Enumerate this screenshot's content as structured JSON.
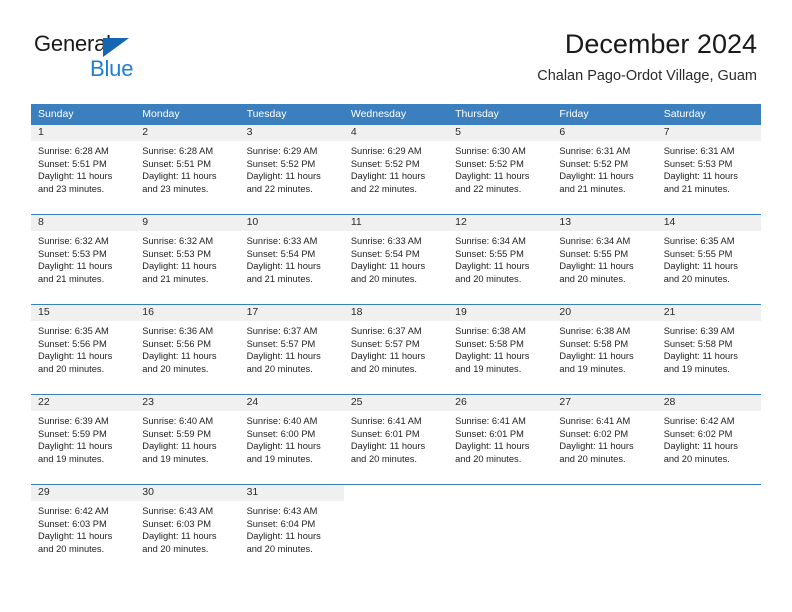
{
  "logo": {
    "word_one": "General",
    "word_two": "Blue",
    "triangle_color": "#1565b0",
    "blue_color": "#1d7fd4"
  },
  "header": {
    "title": "December 2024",
    "subtitle": "Chalan Pago-Ordot Village, Guam"
  },
  "theme": {
    "header_blue": "#3c7fbf",
    "daynum_band": "#f0f0f0",
    "text": "#1f1f1f"
  },
  "weekdays": [
    "Sunday",
    "Monday",
    "Tuesday",
    "Wednesday",
    "Thursday",
    "Friday",
    "Saturday"
  ],
  "weeks": [
    {
      "days": [
        {
          "day": "1",
          "sunrise": "Sunrise: 6:28 AM",
          "sunset": "Sunset: 5:51 PM",
          "daylight_1": "Daylight: 11 hours",
          "daylight_2": "and 23 minutes."
        },
        {
          "day": "2",
          "sunrise": "Sunrise: 6:28 AM",
          "sunset": "Sunset: 5:51 PM",
          "daylight_1": "Daylight: 11 hours",
          "daylight_2": "and 23 minutes."
        },
        {
          "day": "3",
          "sunrise": "Sunrise: 6:29 AM",
          "sunset": "Sunset: 5:52 PM",
          "daylight_1": "Daylight: 11 hours",
          "daylight_2": "and 22 minutes."
        },
        {
          "day": "4",
          "sunrise": "Sunrise: 6:29 AM",
          "sunset": "Sunset: 5:52 PM",
          "daylight_1": "Daylight: 11 hours",
          "daylight_2": "and 22 minutes."
        },
        {
          "day": "5",
          "sunrise": "Sunrise: 6:30 AM",
          "sunset": "Sunset: 5:52 PM",
          "daylight_1": "Daylight: 11 hours",
          "daylight_2": "and 22 minutes."
        },
        {
          "day": "6",
          "sunrise": "Sunrise: 6:31 AM",
          "sunset": "Sunset: 5:52 PM",
          "daylight_1": "Daylight: 11 hours",
          "daylight_2": "and 21 minutes."
        },
        {
          "day": "7",
          "sunrise": "Sunrise: 6:31 AM",
          "sunset": "Sunset: 5:53 PM",
          "daylight_1": "Daylight: 11 hours",
          "daylight_2": "and 21 minutes."
        }
      ]
    },
    {
      "days": [
        {
          "day": "8",
          "sunrise": "Sunrise: 6:32 AM",
          "sunset": "Sunset: 5:53 PM",
          "daylight_1": "Daylight: 11 hours",
          "daylight_2": "and 21 minutes."
        },
        {
          "day": "9",
          "sunrise": "Sunrise: 6:32 AM",
          "sunset": "Sunset: 5:53 PM",
          "daylight_1": "Daylight: 11 hours",
          "daylight_2": "and 21 minutes."
        },
        {
          "day": "10",
          "sunrise": "Sunrise: 6:33 AM",
          "sunset": "Sunset: 5:54 PM",
          "daylight_1": "Daylight: 11 hours",
          "daylight_2": "and 21 minutes."
        },
        {
          "day": "11",
          "sunrise": "Sunrise: 6:33 AM",
          "sunset": "Sunset: 5:54 PM",
          "daylight_1": "Daylight: 11 hours",
          "daylight_2": "and 20 minutes."
        },
        {
          "day": "12",
          "sunrise": "Sunrise: 6:34 AM",
          "sunset": "Sunset: 5:55 PM",
          "daylight_1": "Daylight: 11 hours",
          "daylight_2": "and 20 minutes."
        },
        {
          "day": "13",
          "sunrise": "Sunrise: 6:34 AM",
          "sunset": "Sunset: 5:55 PM",
          "daylight_1": "Daylight: 11 hours",
          "daylight_2": "and 20 minutes."
        },
        {
          "day": "14",
          "sunrise": "Sunrise: 6:35 AM",
          "sunset": "Sunset: 5:55 PM",
          "daylight_1": "Daylight: 11 hours",
          "daylight_2": "and 20 minutes."
        }
      ]
    },
    {
      "days": [
        {
          "day": "15",
          "sunrise": "Sunrise: 6:35 AM",
          "sunset": "Sunset: 5:56 PM",
          "daylight_1": "Daylight: 11 hours",
          "daylight_2": "and 20 minutes."
        },
        {
          "day": "16",
          "sunrise": "Sunrise: 6:36 AM",
          "sunset": "Sunset: 5:56 PM",
          "daylight_1": "Daylight: 11 hours",
          "daylight_2": "and 20 minutes."
        },
        {
          "day": "17",
          "sunrise": "Sunrise: 6:37 AM",
          "sunset": "Sunset: 5:57 PM",
          "daylight_1": "Daylight: 11 hours",
          "daylight_2": "and 20 minutes."
        },
        {
          "day": "18",
          "sunrise": "Sunrise: 6:37 AM",
          "sunset": "Sunset: 5:57 PM",
          "daylight_1": "Daylight: 11 hours",
          "daylight_2": "and 20 minutes."
        },
        {
          "day": "19",
          "sunrise": "Sunrise: 6:38 AM",
          "sunset": "Sunset: 5:58 PM",
          "daylight_1": "Daylight: 11 hours",
          "daylight_2": "and 19 minutes."
        },
        {
          "day": "20",
          "sunrise": "Sunrise: 6:38 AM",
          "sunset": "Sunset: 5:58 PM",
          "daylight_1": "Daylight: 11 hours",
          "daylight_2": "and 19 minutes."
        },
        {
          "day": "21",
          "sunrise": "Sunrise: 6:39 AM",
          "sunset": "Sunset: 5:58 PM",
          "daylight_1": "Daylight: 11 hours",
          "daylight_2": "and 19 minutes."
        }
      ]
    },
    {
      "days": [
        {
          "day": "22",
          "sunrise": "Sunrise: 6:39 AM",
          "sunset": "Sunset: 5:59 PM",
          "daylight_1": "Daylight: 11 hours",
          "daylight_2": "and 19 minutes."
        },
        {
          "day": "23",
          "sunrise": "Sunrise: 6:40 AM",
          "sunset": "Sunset: 5:59 PM",
          "daylight_1": "Daylight: 11 hours",
          "daylight_2": "and 19 minutes."
        },
        {
          "day": "24",
          "sunrise": "Sunrise: 6:40 AM",
          "sunset": "Sunset: 6:00 PM",
          "daylight_1": "Daylight: 11 hours",
          "daylight_2": "and 19 minutes."
        },
        {
          "day": "25",
          "sunrise": "Sunrise: 6:41 AM",
          "sunset": "Sunset: 6:01 PM",
          "daylight_1": "Daylight: 11 hours",
          "daylight_2": "and 20 minutes."
        },
        {
          "day": "26",
          "sunrise": "Sunrise: 6:41 AM",
          "sunset": "Sunset: 6:01 PM",
          "daylight_1": "Daylight: 11 hours",
          "daylight_2": "and 20 minutes."
        },
        {
          "day": "27",
          "sunrise": "Sunrise: 6:41 AM",
          "sunset": "Sunset: 6:02 PM",
          "daylight_1": "Daylight: 11 hours",
          "daylight_2": "and 20 minutes."
        },
        {
          "day": "28",
          "sunrise": "Sunrise: 6:42 AM",
          "sunset": "Sunset: 6:02 PM",
          "daylight_1": "Daylight: 11 hours",
          "daylight_2": "and 20 minutes."
        }
      ]
    },
    {
      "days": [
        {
          "day": "29",
          "sunrise": "Sunrise: 6:42 AM",
          "sunset": "Sunset: 6:03 PM",
          "daylight_1": "Daylight: 11 hours",
          "daylight_2": "and 20 minutes."
        },
        {
          "day": "30",
          "sunrise": "Sunrise: 6:43 AM",
          "sunset": "Sunset: 6:03 PM",
          "daylight_1": "Daylight: 11 hours",
          "daylight_2": "and 20 minutes."
        },
        {
          "day": "31",
          "sunrise": "Sunrise: 6:43 AM",
          "sunset": "Sunset: 6:04 PM",
          "daylight_1": "Daylight: 11 hours",
          "daylight_2": "and 20 minutes."
        },
        {
          "day": "",
          "sunrise": "",
          "sunset": "",
          "daylight_1": "",
          "daylight_2": ""
        },
        {
          "day": "",
          "sunrise": "",
          "sunset": "",
          "daylight_1": "",
          "daylight_2": ""
        },
        {
          "day": "",
          "sunrise": "",
          "sunset": "",
          "daylight_1": "",
          "daylight_2": ""
        },
        {
          "day": "",
          "sunrise": "",
          "sunset": "",
          "daylight_1": "",
          "daylight_2": ""
        }
      ]
    }
  ]
}
